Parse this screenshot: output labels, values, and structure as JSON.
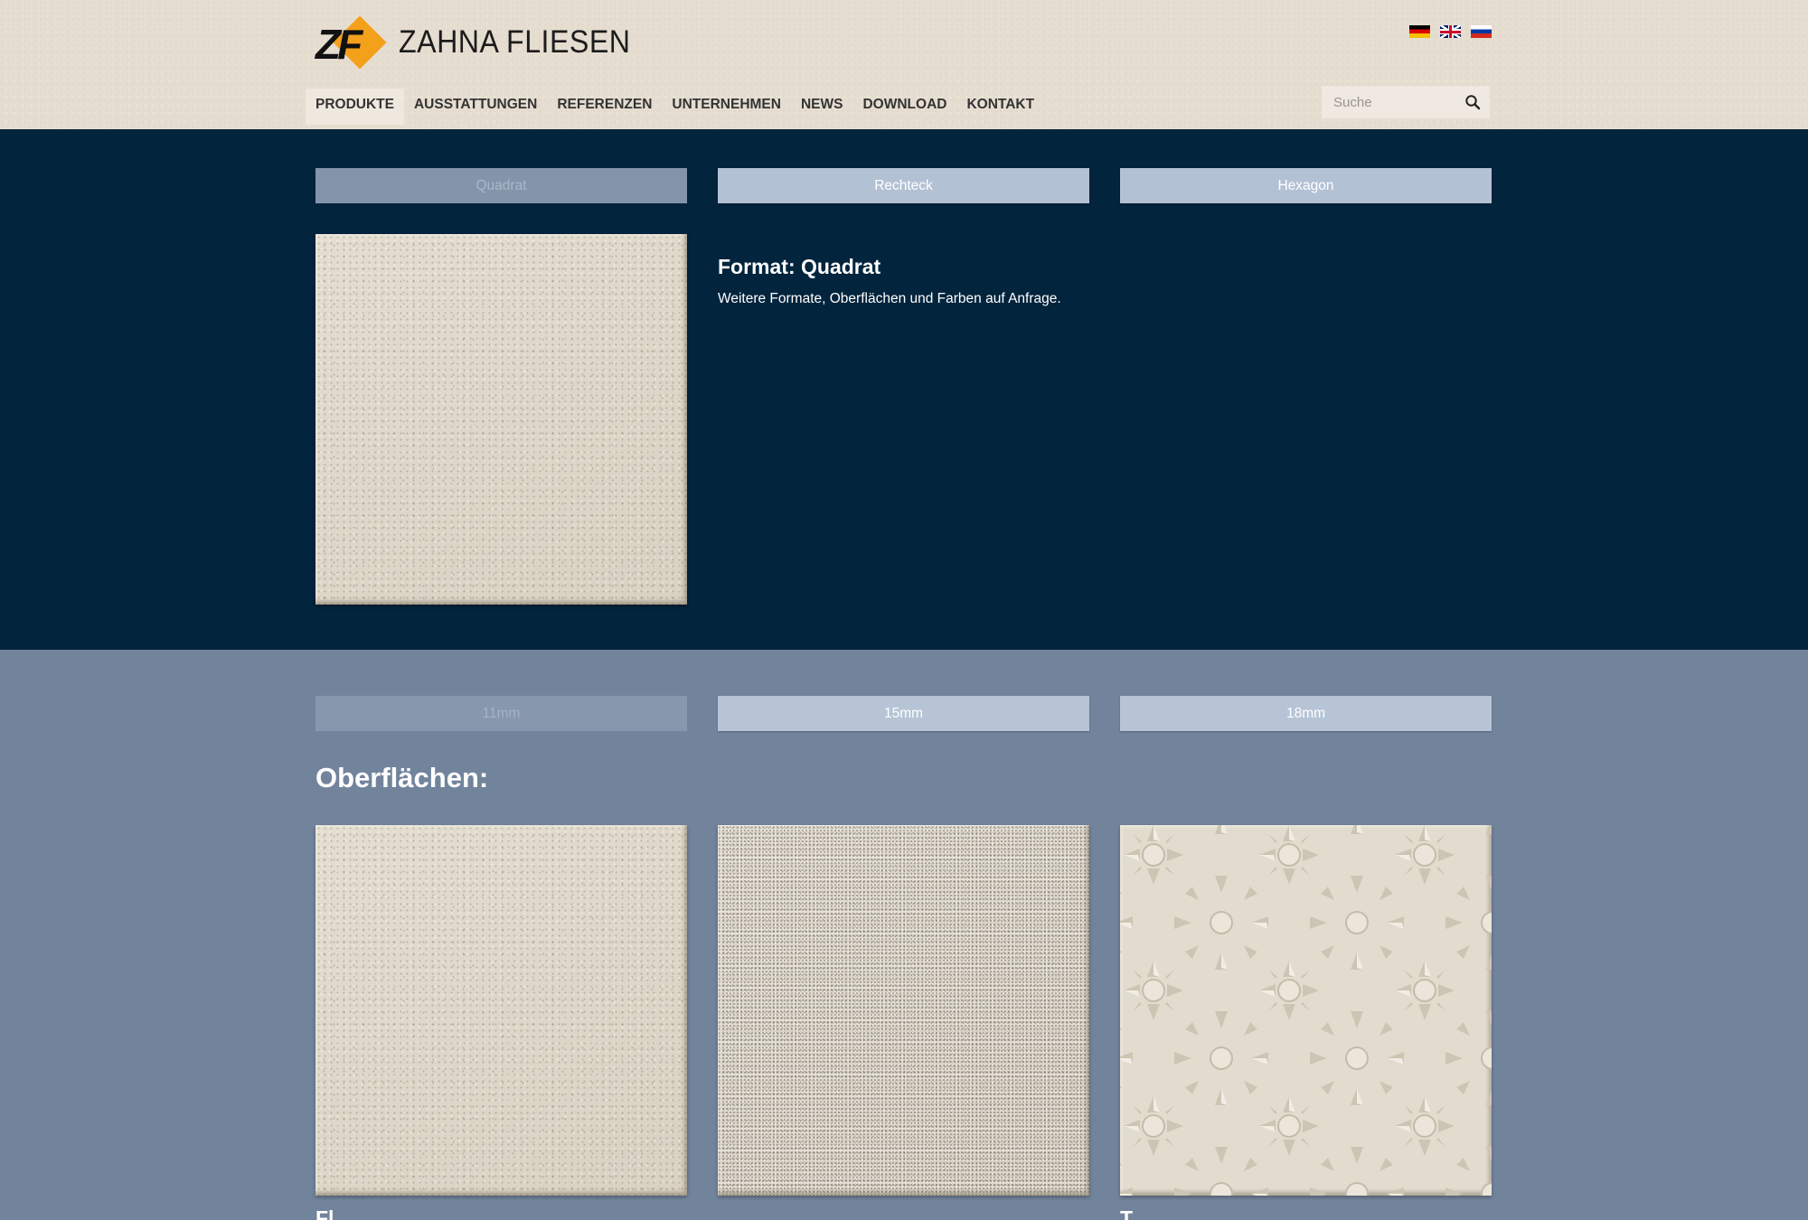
{
  "brand": {
    "logo_letters": "ZF",
    "name": "ZAHNA FLIESEN",
    "accent_color": "#f3a01b"
  },
  "languages": [
    {
      "code": "de",
      "icon": "flag-germany-icon"
    },
    {
      "code": "en",
      "icon": "flag-uk-icon"
    },
    {
      "code": "ru",
      "icon": "flag-russia-icon"
    }
  ],
  "nav": {
    "items": [
      {
        "label": "PRODUKTE",
        "active": true
      },
      {
        "label": "AUSSTATTUNGEN"
      },
      {
        "label": "REFERENZEN"
      },
      {
        "label": "UNTERNEHMEN"
      },
      {
        "label": "NEWS"
      },
      {
        "label": "DOWNLOAD"
      },
      {
        "label": "KONTAKT"
      }
    ]
  },
  "search": {
    "placeholder": "Suche",
    "icon": "search-icon"
  },
  "format_tabs": [
    {
      "label": "Quadrat",
      "active": true
    },
    {
      "label": "Rechteck"
    },
    {
      "label": "Hexagon"
    }
  ],
  "format": {
    "title": "Format: Quadrat",
    "description": "Weitere Formate, Oberflächen und Farben auf Anfrage."
  },
  "thickness_tabs": [
    {
      "label": "11mm",
      "active": true
    },
    {
      "label": "15mm"
    },
    {
      "label": "18mm"
    }
  ],
  "surfaces": {
    "title": "Oberflächen:",
    "items": [
      {
        "label": "Fl..."
      },
      {
        "label": "..."
      },
      {
        "label": "T..."
      }
    ]
  },
  "colors": {
    "dark_section": "#02243d",
    "light_section": "#72849c",
    "header": "#e6ddd1"
  }
}
